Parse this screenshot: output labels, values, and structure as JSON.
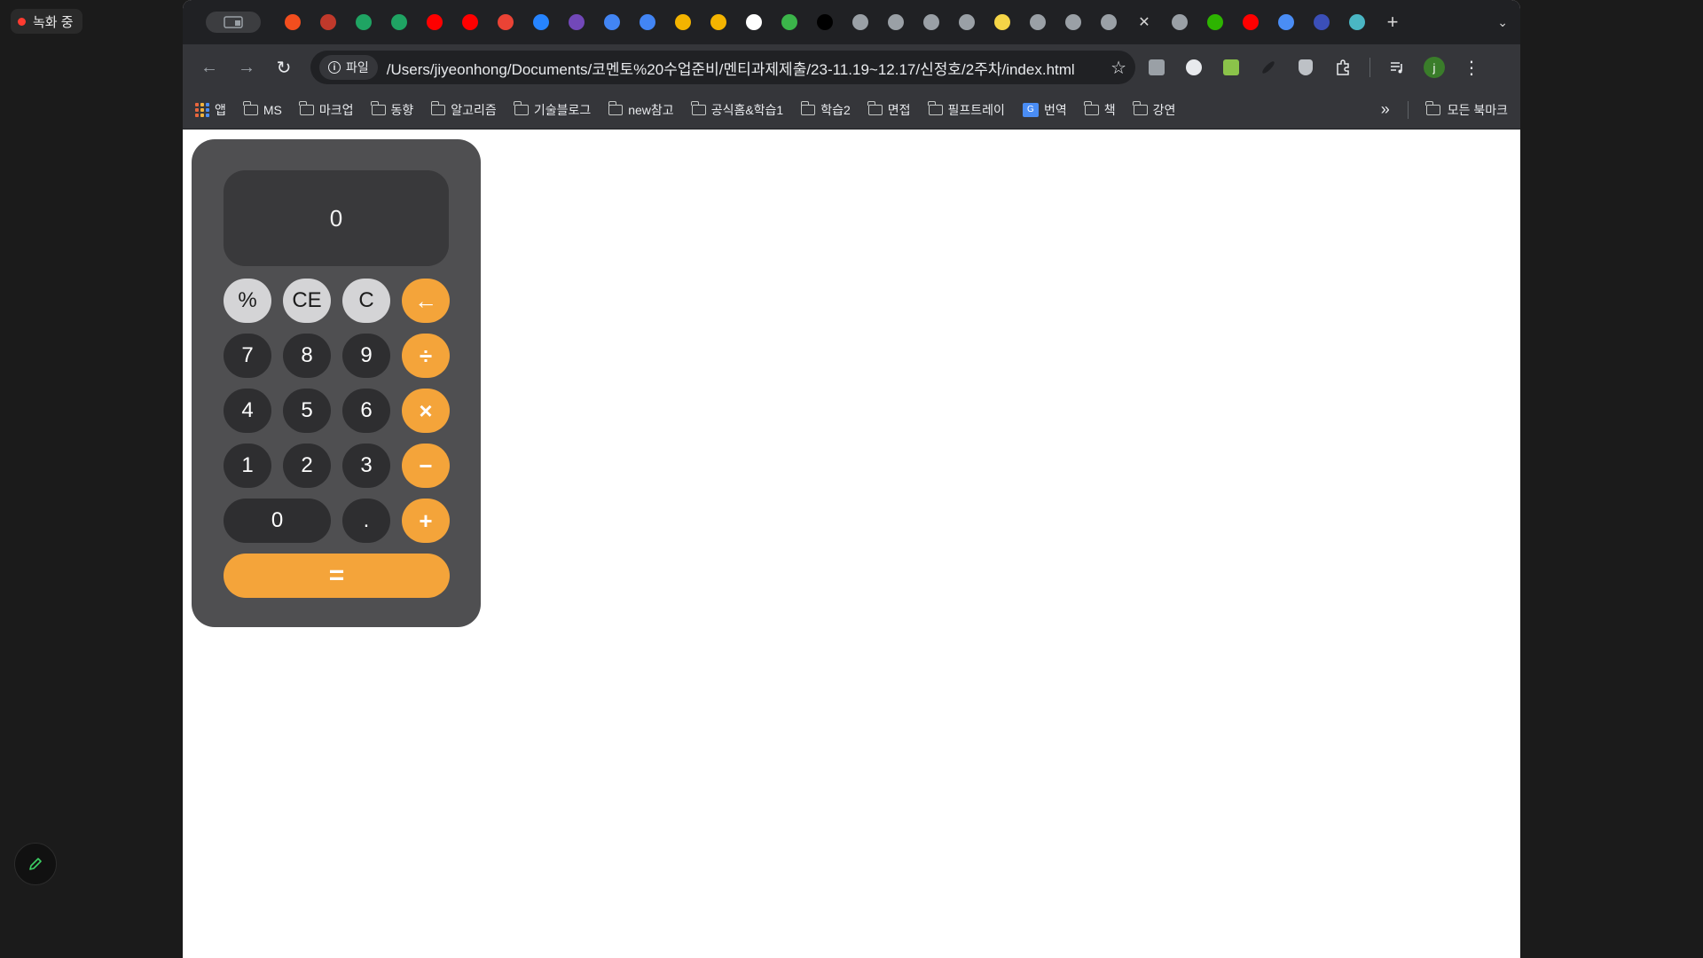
{
  "recording": {
    "label": "녹화 중"
  },
  "tabs": {
    "favicons": [
      {
        "name": "figma-tab",
        "color": "#f24e1e"
      },
      {
        "name": "notion-red-tab",
        "color": "#c0392b"
      },
      {
        "name": "sheets-tab-1",
        "color": "#1fa463"
      },
      {
        "name": "sheets-tab-2",
        "color": "#1fa463"
      },
      {
        "name": "youtube-tab-1",
        "color": "#ff0000"
      },
      {
        "name": "youtube-tab-2",
        "color": "#ff0000"
      },
      {
        "name": "gmail-tab",
        "color": "#ea4335"
      },
      {
        "name": "jira-tab",
        "color": "#2684ff"
      },
      {
        "name": "forms-tab",
        "color": "#7248b9"
      },
      {
        "name": "docs-tab-1",
        "color": "#4285f4"
      },
      {
        "name": "docs-tab-2",
        "color": "#4285f4"
      },
      {
        "name": "slides-tab-1",
        "color": "#f4b400"
      },
      {
        "name": "slides-tab-2",
        "color": "#f4b400"
      },
      {
        "name": "github-tab",
        "color": "#ffffff"
      },
      {
        "name": "leaf-tab",
        "color": "#3bb54a"
      },
      {
        "name": "r-tab",
        "color": "#000000"
      },
      {
        "name": "globe-tab-1",
        "color": "#9aa0a6"
      },
      {
        "name": "globe-tab-2",
        "color": "#9aa0a6"
      },
      {
        "name": "globe-tab-3",
        "color": "#9aa0a6"
      },
      {
        "name": "globe-tab-4",
        "color": "#9aa0a6"
      },
      {
        "name": "mj-tab",
        "color": "#f5d547"
      },
      {
        "name": "globe-tab-5",
        "color": "#9aa0a6"
      },
      {
        "name": "globe-tab-6",
        "color": "#9aa0a6"
      },
      {
        "name": "globe-tab-7",
        "color": "#9aa0a6"
      }
    ],
    "after_close": [
      {
        "name": "globe-tab-8",
        "color": "#9aa0a6"
      },
      {
        "name": "naver-tab",
        "color": "#2db400"
      },
      {
        "name": "youtube-tab-3",
        "color": "#ff0000"
      },
      {
        "name": "s-tab",
        "color": "#4a8df5"
      },
      {
        "name": "monitor-tab",
        "color": "#3b4fb8"
      },
      {
        "name": "circle-tab",
        "color": "#4ab6c4"
      }
    ],
    "close_symbol": "✕",
    "new_tab_symbol": "+",
    "menu_symbol": "⌄"
  },
  "toolbar": {
    "back": "←",
    "forward": "→",
    "reload": "↻",
    "chip_label": "파일",
    "url": "/Users/jiyeonhong/Documents/코멘토%20수업준비/멘티과제제출/23-11.19~12.17/신정호/2주차/index.html",
    "bookmark_star": "☆",
    "profile_initial": "j",
    "menu": "⋮"
  },
  "bookmarks": {
    "apps_label": "앱",
    "folders": [
      "MS",
      "마크업",
      "동향",
      "알고리즘",
      "기술블로그",
      "new참고",
      "공식홈&학습1",
      "학습2",
      "면접",
      "필프트레이"
    ],
    "translate_label": "번역",
    "folders_after": [
      "책",
      "강연"
    ],
    "more": "»",
    "all_label": "모든 북마크"
  },
  "calculator": {
    "display": "0",
    "keys": [
      {
        "label": "%",
        "style": "light",
        "name": "percent-key"
      },
      {
        "label": "CE",
        "style": "light",
        "name": "clear-entry-key"
      },
      {
        "label": "C",
        "style": "light",
        "name": "clear-key"
      },
      {
        "label": "←",
        "style": "orange",
        "name": "backspace-key"
      },
      {
        "label": "7",
        "style": "dark",
        "name": "digit-7-key"
      },
      {
        "label": "8",
        "style": "dark",
        "name": "digit-8-key"
      },
      {
        "label": "9",
        "style": "dark",
        "name": "digit-9-key"
      },
      {
        "label": "÷",
        "style": "orange",
        "name": "divide-key"
      },
      {
        "label": "4",
        "style": "dark",
        "name": "digit-4-key"
      },
      {
        "label": "5",
        "style": "dark",
        "name": "digit-5-key"
      },
      {
        "label": "6",
        "style": "dark",
        "name": "digit-6-key"
      },
      {
        "label": "×",
        "style": "orange",
        "name": "multiply-key"
      },
      {
        "label": "1",
        "style": "dark",
        "name": "digit-1-key"
      },
      {
        "label": "2",
        "style": "dark",
        "name": "digit-2-key"
      },
      {
        "label": "3",
        "style": "dark",
        "name": "digit-3-key"
      },
      {
        "label": "−",
        "style": "orange",
        "name": "subtract-key"
      },
      {
        "label": "0",
        "style": "dark zero",
        "name": "digit-0-key"
      },
      {
        "label": ".",
        "style": "dark",
        "name": "decimal-key"
      },
      {
        "label": "+",
        "style": "orange",
        "name": "add-key"
      },
      {
        "label": "=",
        "style": "eq",
        "name": "equals-key"
      }
    ]
  },
  "colors": {
    "calc_body": "#4f4f51",
    "display_bg": "#39393b",
    "operator": "#f4a43a",
    "light_key": "#d4d4d6",
    "dark_key": "#2e2e30"
  }
}
